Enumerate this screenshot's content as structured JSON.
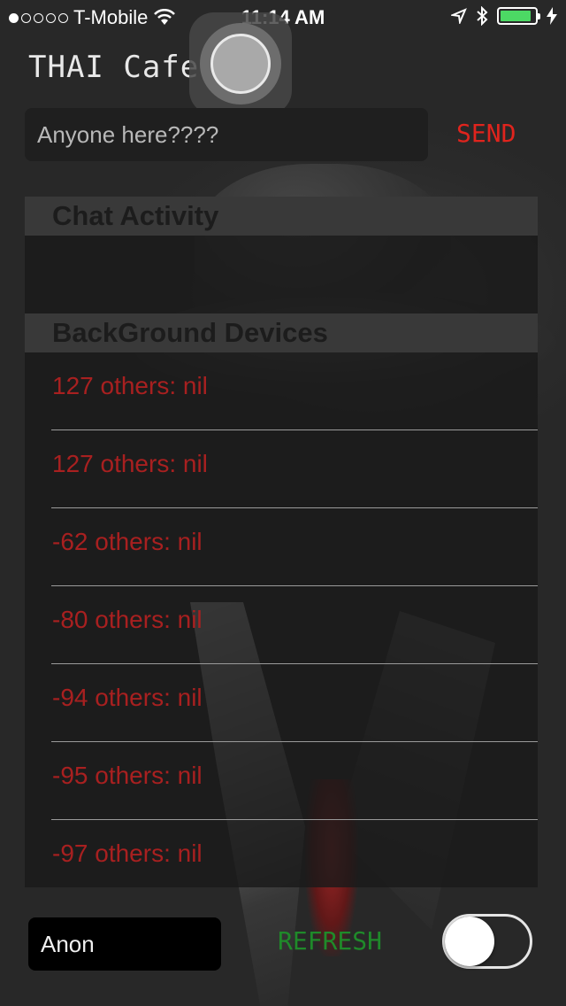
{
  "status_bar": {
    "carrier": "T-Mobile",
    "time": "11:14 AM",
    "signal_bars_filled": 1,
    "signal_bars_total": 5,
    "battery_level": 0.9,
    "battery_color": "#4cd964"
  },
  "header": {
    "title": "THAI Cafe"
  },
  "message": {
    "placeholder": "Anyone here????",
    "value": "",
    "send_label": "SEND"
  },
  "sections": {
    "chat_activity": {
      "title": "Chat Activity"
    },
    "background_devices": {
      "title": "BackGround Devices",
      "items": [
        "127  others: nil",
        "127  others: nil",
        "-62  others: nil",
        "-80  others: nil",
        "-94  others: nil",
        "-95  others: nil",
        "-97  others: nil"
      ]
    }
  },
  "footer": {
    "name_value": "Anon",
    "refresh_label": "REFRESH",
    "toggle_on": false
  },
  "colors": {
    "accent_red": "#e0241d",
    "row_text": "#a82020",
    "refresh_green": "#1f8a2a"
  }
}
